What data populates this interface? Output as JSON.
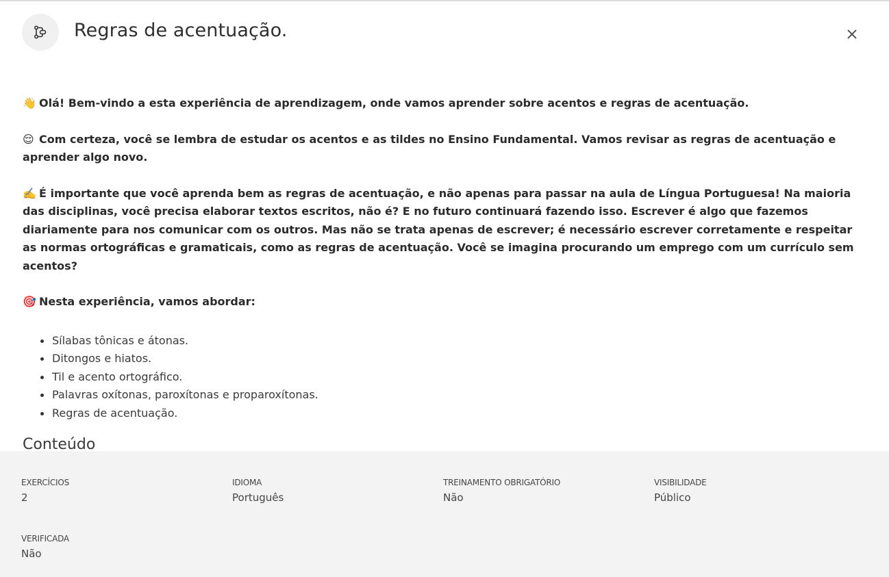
{
  "header": {
    "title": "Regras de acentuação.",
    "icon": "flow-diagram-icon",
    "close_label": "×"
  },
  "content": {
    "paragraphs": [
      {
        "emoji": "👋",
        "text": "Olá! Bem-vindo a esta experiência de aprendizagem, onde vamos aprender sobre acentos e regras de acentuação."
      },
      {
        "emoji": "😌",
        "text": "Com certeza, você se lembra de estudar os acentos e as tildes no Ensino Fundamental. Vamos revisar as regras de acentuação e aprender algo novo."
      },
      {
        "emoji": "✍️",
        "text": "É importante que você aprenda bem as regras de acentuação, e não apenas para passar na aula de Língua Portuguesa! Na maioria das disciplinas, você precisa elaborar textos escritos, não é? E no futuro continuará fazendo isso. Escrever é algo que fazemos diariamente para nos comunicar com os outros. Mas não se trata apenas de escrever; é necessário escrever corretamente e respeitar as normas ortográficas e gramaticais, como as regras de acentuação. Você se imagina procurando um emprego com um currículo sem acentos?"
      },
      {
        "emoji": "🎯",
        "text": "Nesta experiência, vamos abordar:"
      }
    ],
    "topics": [
      "Sílabas tônicas e átonas.",
      "Ditongos e hiatos.",
      "Til e acento ortográfico.",
      "Palavras oxítonas, paroxítonas e proparoxítonas.",
      "Regras de acentuação."
    ],
    "section_heading": "Conteúdo"
  },
  "info": {
    "exercicios": {
      "label": "EXERCÍCIOS",
      "value": "2"
    },
    "idioma": {
      "label": "IDIOMA",
      "value": "Português"
    },
    "treinamento": {
      "label": "TREINAMENTO OBRIGATÓRIO",
      "value": "Não"
    },
    "visibilidade": {
      "label": "VISIBILIDADE",
      "value": "Público"
    },
    "verificada": {
      "label": "VERIFICADA",
      "value": "Não"
    }
  }
}
